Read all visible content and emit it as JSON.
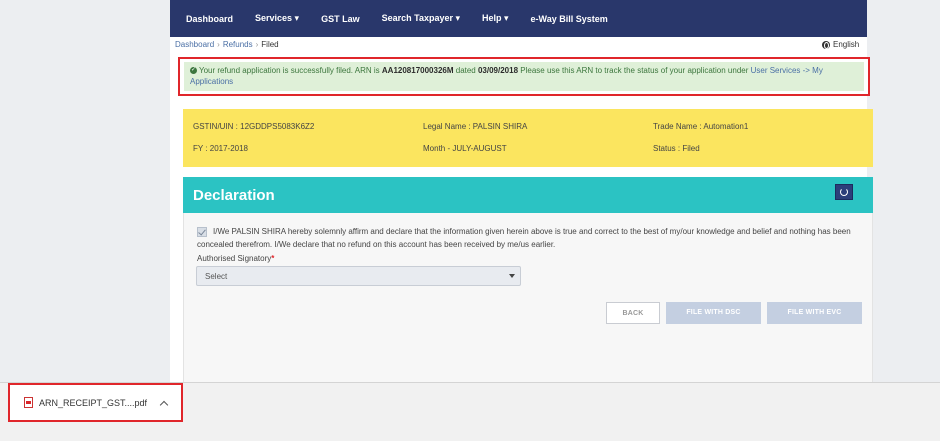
{
  "nav": {
    "items": [
      "Dashboard",
      "Services ▾",
      "GST Law",
      "Search Taxpayer ▾",
      "Help ▾",
      "e-Way Bill System"
    ]
  },
  "breadcrumb": {
    "dashboard": "Dashboard",
    "refunds": "Refunds",
    "current": "Filed",
    "sep": "›"
  },
  "language": "English",
  "alert": {
    "prefix": "Your refund application is successfully filed. ARN is ",
    "arn": "AA120817000326M",
    "mid": " dated ",
    "date": "03/09/2018",
    "suffix": " Please use this ARN to track the status of your application under ",
    "link": "User Services -> My Applications"
  },
  "info": {
    "gstin": "GSTIN/UIN : 12GDDPS5083K6Z2",
    "legal_name": "Legal Name : PALSIN SHIRA",
    "trade_name": "Trade Name : Automation1",
    "fy": "FY : 2017-2018",
    "month": "Month - JULY-AUGUST",
    "status": "Status : Filed"
  },
  "declaration": {
    "title": "Declaration",
    "text": "I/We PALSIN SHIRA hereby solemnly affirm and declare that the information given herein above is true and correct to the best of my/our knowledge and belief and nothing has been concealed therefrom. I/We declare that no refund on this account has been received by me/us earlier.",
    "signatory_label": "Authorised Signatory",
    "required_mark": "*",
    "signatory_value": "Select"
  },
  "buttons": {
    "back": "BACK",
    "file_dsc": "FILE WITH DSC",
    "file_evc": "FILE WITH EVC"
  },
  "download": {
    "filename": "ARN_RECEIPT_GST....pdf"
  }
}
